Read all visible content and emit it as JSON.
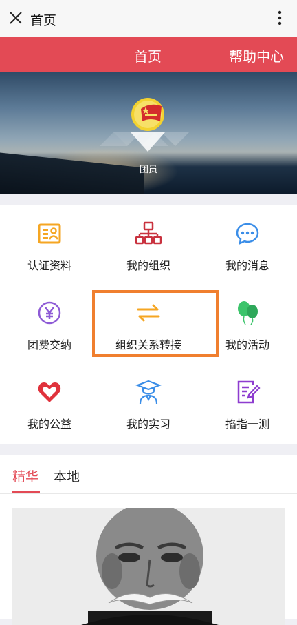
{
  "topbar": {
    "title": "首页"
  },
  "redbar": {
    "home": "首页",
    "help": "帮助中心"
  },
  "banner": {
    "member_label": "团员"
  },
  "grid": {
    "items": [
      {
        "label": "认证资料",
        "icon": "id-card-icon",
        "color": "#f5a623"
      },
      {
        "label": "我的组织",
        "icon": "org-chart-icon",
        "color": "#c9323f"
      },
      {
        "label": "我的消息",
        "icon": "chat-bubble-icon",
        "color": "#3b8ee8"
      },
      {
        "label": "团费交纳",
        "icon": "yen-coin-icon",
        "color": "#8e5bd6"
      },
      {
        "label": "组织关系转接",
        "icon": "transfer-arrows-icon",
        "color": "#f5a623"
      },
      {
        "label": "我的活动",
        "icon": "balloons-icon",
        "color": "#3cc46b"
      },
      {
        "label": "我的公益",
        "icon": "heart-hands-icon",
        "color": "#e0323c"
      },
      {
        "label": "我的实习",
        "icon": "graduate-icon",
        "color": "#3b8ee8"
      },
      {
        "label": "掐指一测",
        "icon": "edit-note-icon",
        "color": "#8e3ccf"
      }
    ],
    "highlight_color": "#f07f2f"
  },
  "tabs": [
    {
      "label": "精华",
      "active": true
    },
    {
      "label": "本地",
      "active": false
    }
  ],
  "colors": {
    "accent": "#e34a55"
  }
}
